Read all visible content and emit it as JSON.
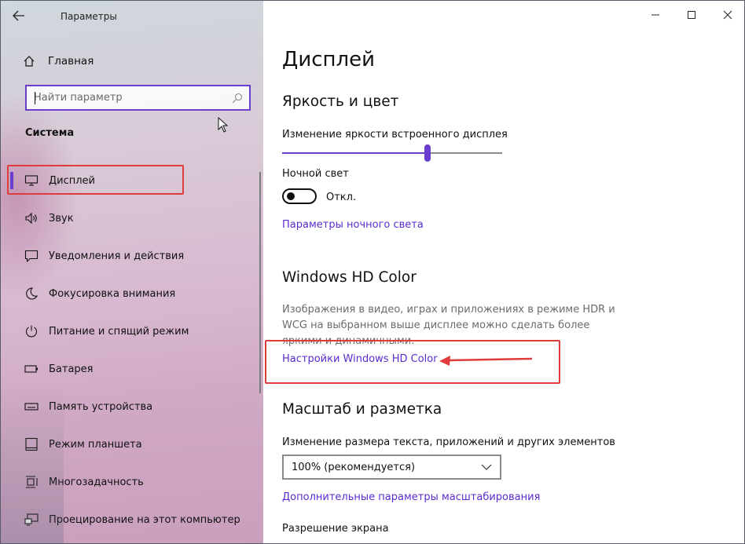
{
  "window": {
    "title": "Параметры",
    "back_icon": "arrow-left-icon",
    "controls": {
      "minimize": "—",
      "maximize": "☐",
      "close": "✕"
    }
  },
  "sidebar": {
    "home_label": "Главная",
    "search": {
      "placeholder": "Найти параметр",
      "icon": "search-icon"
    },
    "section": "Система",
    "items": [
      {
        "label": "Дисплей",
        "icon": "monitor-icon",
        "active": true
      },
      {
        "label": "Звук",
        "icon": "speaker-icon"
      },
      {
        "label": "Уведомления и действия",
        "icon": "notification-icon"
      },
      {
        "label": "Фокусировка внимания",
        "icon": "moon-icon"
      },
      {
        "label": "Питание и спящий режим",
        "icon": "power-icon"
      },
      {
        "label": "Батарея",
        "icon": "battery-icon"
      },
      {
        "label": "Память устройства",
        "icon": "storage-icon"
      },
      {
        "label": "Режим планшета",
        "icon": "tablet-icon"
      },
      {
        "label": "Многозадачность",
        "icon": "multitask-icon"
      },
      {
        "label": "Проецирование на этот компьютер",
        "icon": "project-icon"
      }
    ]
  },
  "main": {
    "title": "Дисплей",
    "brightness": {
      "heading": "Яркость и цвет",
      "slider_label": "Изменение яркости встроенного дисплея",
      "slider_value": 0.66
    },
    "night_light": {
      "label": "Ночной свет",
      "state": "Откл.",
      "settings_link": "Параметры ночного света"
    },
    "hd_color": {
      "heading": "Windows HD Color",
      "description": "Изображения в видео, играх и приложениях в режиме HDR и WCG на выбранном выше дисплее можно сделать более яркими и динамичными.",
      "link": "Настройки Windows HD Color"
    },
    "scale": {
      "heading": "Масштаб и разметка",
      "label": "Изменение размера текста, приложений и других элементов",
      "selected": "100% (рекомендуется)",
      "advanced_link": "Дополнительные параметры масштабирования",
      "resolution_label": "Разрешение экрана"
    }
  },
  "colors": {
    "accent": "#6a3fd0",
    "link": "#5a2ccf",
    "highlight": "#e03c3c"
  }
}
